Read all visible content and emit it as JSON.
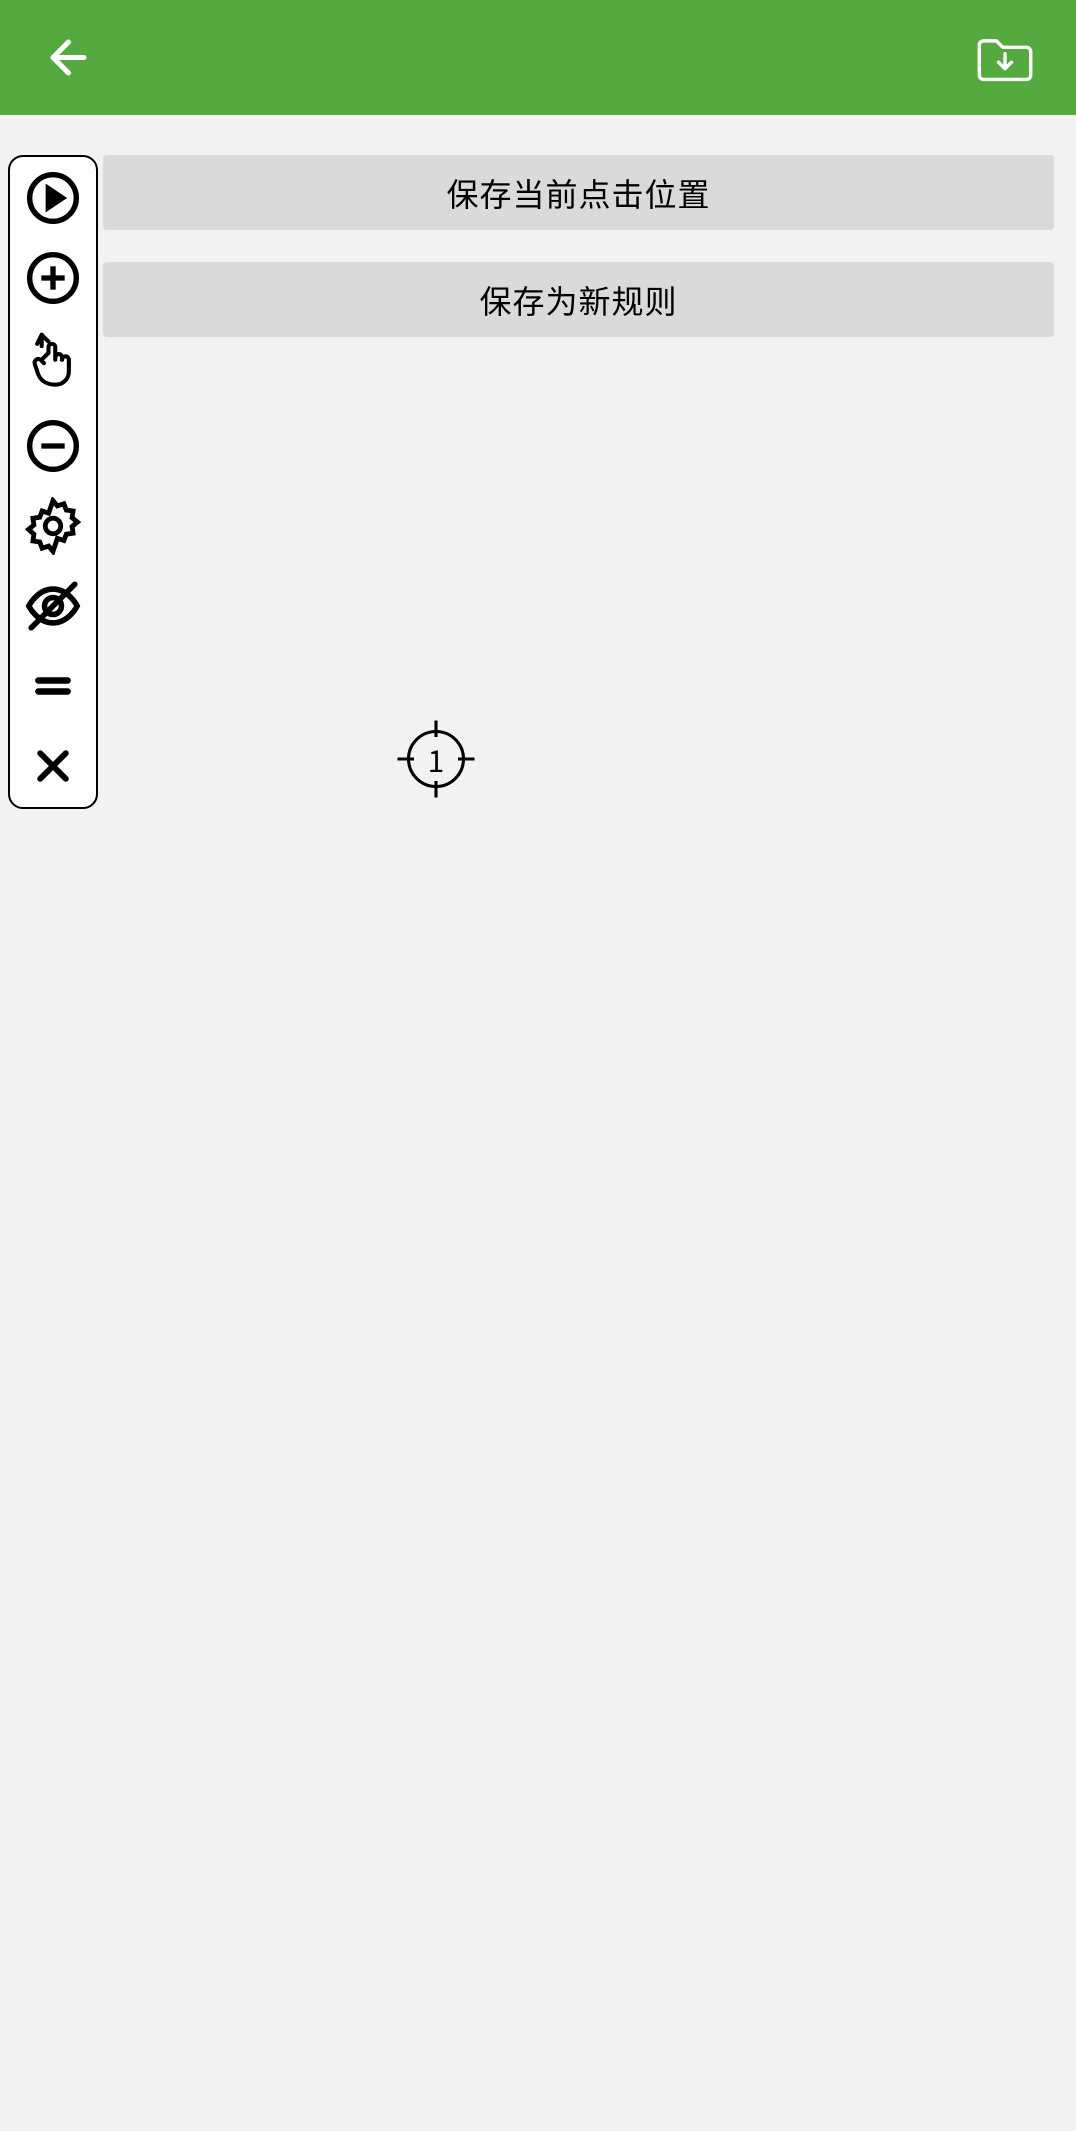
{
  "header": {
    "back_icon": "back-arrow",
    "folder_icon": "folder-download"
  },
  "options": {
    "save_position_label": "保存当前点击位置",
    "save_rule_label": "保存为新规则"
  },
  "toolbar": {
    "play_icon": "play",
    "add_icon": "plus",
    "swipe_icon": "swipe-up",
    "minus_icon": "minus",
    "settings_icon": "gear",
    "hide_icon": "eye-off",
    "drag_icon": "drag-handle",
    "close_icon": "close"
  },
  "target": {
    "number": "1"
  },
  "colors": {
    "header_bg": "#55aa3f",
    "body_bg": "#f2f2f2",
    "button_bg": "#dadada"
  }
}
